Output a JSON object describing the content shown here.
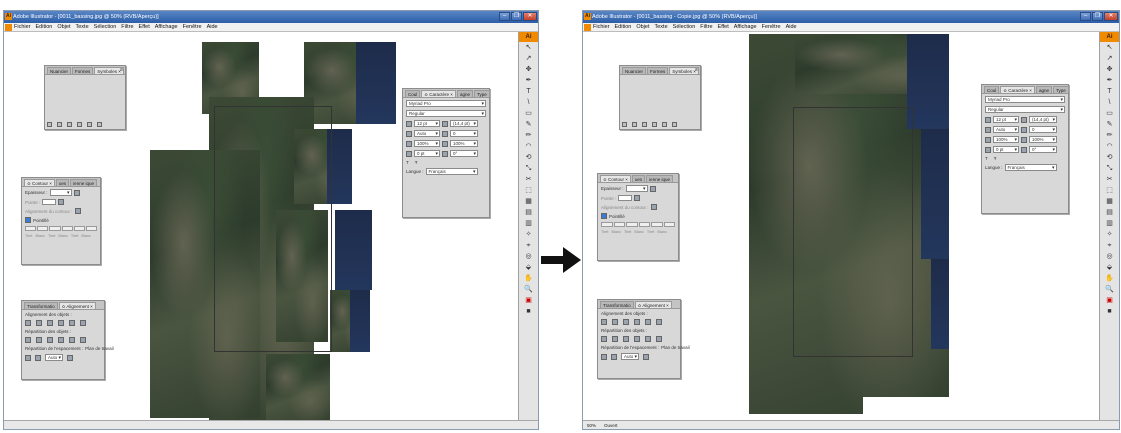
{
  "left_window": {
    "title": "Adobe Illustrator - [0011_bassing.jpg @ 50% (RVB/Aperçu)]",
    "status_zoom": "",
    "status_mode": ""
  },
  "right_window": {
    "title": "Adobe Illustrator - [0011_bassing - Copie.jpg @ 50% (RVB/Aperçu)]",
    "status_zoom": "50%",
    "status_mode": "Ouvert"
  },
  "menu": [
    "Fichier",
    "Edition",
    "Objet",
    "Texte",
    "Sélection",
    "Filtre",
    "Effet",
    "Affichage",
    "Fenêtre",
    "Aide"
  ],
  "window_buttons": {
    "minimize": "–",
    "restore": "❐",
    "close": "✕"
  },
  "toolbar_logo": "Ai",
  "tools": [
    "↖",
    "↗",
    "✥",
    "✒",
    "T",
    "\\",
    "▭",
    "✎",
    "✏",
    "◠",
    "⟲",
    "⤡",
    "✂",
    "⬚",
    "▦",
    "▤",
    "▥",
    "✧",
    "⌖",
    "◎",
    "⬙",
    "✋",
    "🔍",
    "▣",
    "■"
  ],
  "panels": {
    "symbols": {
      "tabs": [
        "Nuancier",
        "Formes",
        "Symboles ×"
      ]
    },
    "contour": {
      "tabs": [
        "≎ Contour ×",
        "ues",
        "ienne ique"
      ],
      "epaisseur": "Epaisseur :",
      "pointe": "Pointe :",
      "alignement": "Alignement du contour :",
      "pointille": "Pointillé",
      "dash_labels": [
        "Tiret",
        "Blanc",
        "Tiret",
        "Blanc",
        "Tiret",
        "Blanc"
      ]
    },
    "align": {
      "tabs": [
        "Transformatio",
        "≎ Alignement ×"
      ],
      "align_objects": "Alignement des objets :",
      "distribute_objects": "Répartition des objets :",
      "distribute_spacing": "Répartition de l'espacement :",
      "align_to": "Plan de travail",
      "auto": "Auto"
    },
    "character": {
      "tabs": [
        "Coul",
        "≎ Caractère ×",
        "agne",
        "Type"
      ],
      "font_family": "Myriad Pro",
      "font_style": "Regular",
      "font_size": "12 pt",
      "leading": "(14,4 pt)",
      "kerning": "Auto",
      "tracking": "0",
      "hscale": "100%",
      "vscale": "100%",
      "baseline": "0 pt",
      "rotation": "0°",
      "language_label": "Langue :",
      "language": "Français"
    }
  },
  "colors": {
    "title_bar": "#2b5ea8",
    "accent_orange": "#f08a00",
    "sea": "#23365c",
    "forest": "#3c4a35"
  }
}
